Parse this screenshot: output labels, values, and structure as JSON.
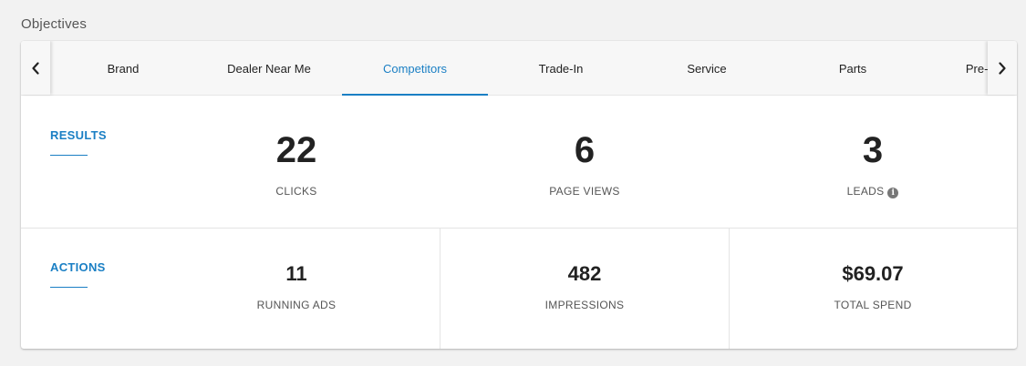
{
  "section": {
    "title": "Objectives"
  },
  "tabs": [
    {
      "label": "Brand",
      "active": false
    },
    {
      "label": "Dealer Near Me",
      "active": false
    },
    {
      "label": "Competitors",
      "active": true
    },
    {
      "label": "Trade-In",
      "active": false
    },
    {
      "label": "Service",
      "active": false
    },
    {
      "label": "Parts",
      "active": false
    },
    {
      "label": "Pre-Order In",
      "active": false
    }
  ],
  "results": {
    "label": "RESULTS",
    "metrics": [
      {
        "value": "22",
        "label": "CLICKS"
      },
      {
        "value": "6",
        "label": "PAGE VIEWS"
      },
      {
        "value": "3",
        "label": "LEADS",
        "info_icon": "info-icon"
      }
    ]
  },
  "actions": {
    "label": "ACTIONS",
    "metrics": [
      {
        "value": "11",
        "label": "RUNNING ADS"
      },
      {
        "value": "482",
        "label": "IMPRESSIONS"
      },
      {
        "value": "$69.07",
        "label": "TOTAL SPEND"
      }
    ]
  },
  "colors": {
    "accent": "#1a7fc4",
    "text": "#222222",
    "muted": "#555555"
  }
}
